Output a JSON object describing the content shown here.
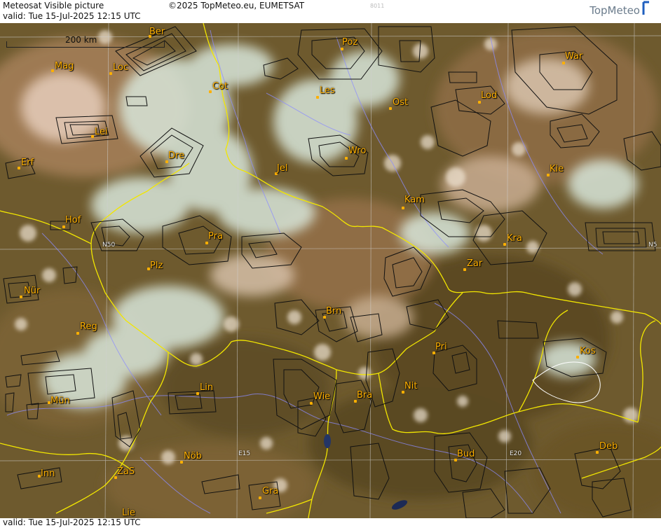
{
  "header": {
    "title": "Meteosat Visible picture",
    "copyright": "©2025 TopMeteo.eu, EUMETSAT",
    "code": "8011",
    "valid": "valid:  Tue  15-Jul-2025  12:15 UTC",
    "logo": "TopMeteo"
  },
  "footer": {
    "valid": "valid:  Tue  15-Jul-2025  12:15 UTC"
  },
  "scale": {
    "label": "200 km"
  },
  "cities": [
    {
      "name": "Ber"
    },
    {
      "name": "Poz"
    },
    {
      "name": "War"
    },
    {
      "name": "Mag"
    },
    {
      "name": "Loc"
    },
    {
      "name": "Cot"
    },
    {
      "name": "Les"
    },
    {
      "name": "Ost"
    },
    {
      "name": "Lod"
    },
    {
      "name": "Lei"
    },
    {
      "name": "Erf"
    },
    {
      "name": "Dre"
    },
    {
      "name": "Jel"
    },
    {
      "name": "Wro"
    },
    {
      "name": "Kie"
    },
    {
      "name": "Kam"
    },
    {
      "name": "Hof"
    },
    {
      "name": "Pra"
    },
    {
      "name": "Kra"
    },
    {
      "name": "Plz"
    },
    {
      "name": "Zar"
    },
    {
      "name": "Nür"
    },
    {
      "name": "Brn"
    },
    {
      "name": "Reg"
    },
    {
      "name": "Pri"
    },
    {
      "name": "Kos"
    },
    {
      "name": "Lin"
    },
    {
      "name": "Mün"
    },
    {
      "name": "Wie"
    },
    {
      "name": "Bra"
    },
    {
      "name": "Nit"
    },
    {
      "name": "Inn"
    },
    {
      "name": "ZaS"
    },
    {
      "name": "Nöb"
    },
    {
      "name": "Bud"
    },
    {
      "name": "Deb"
    },
    {
      "name": "Gra"
    },
    {
      "name": "Lie"
    }
  ],
  "coords": [
    {
      "text": "N50"
    },
    {
      "text": "N5"
    },
    {
      "text": "E15"
    },
    {
      "text": "E20"
    }
  ],
  "colors": {
    "border": "#f2e600",
    "river": "#8c8cff",
    "grid": "#cfcfcf",
    "label": "#ffb000"
  }
}
